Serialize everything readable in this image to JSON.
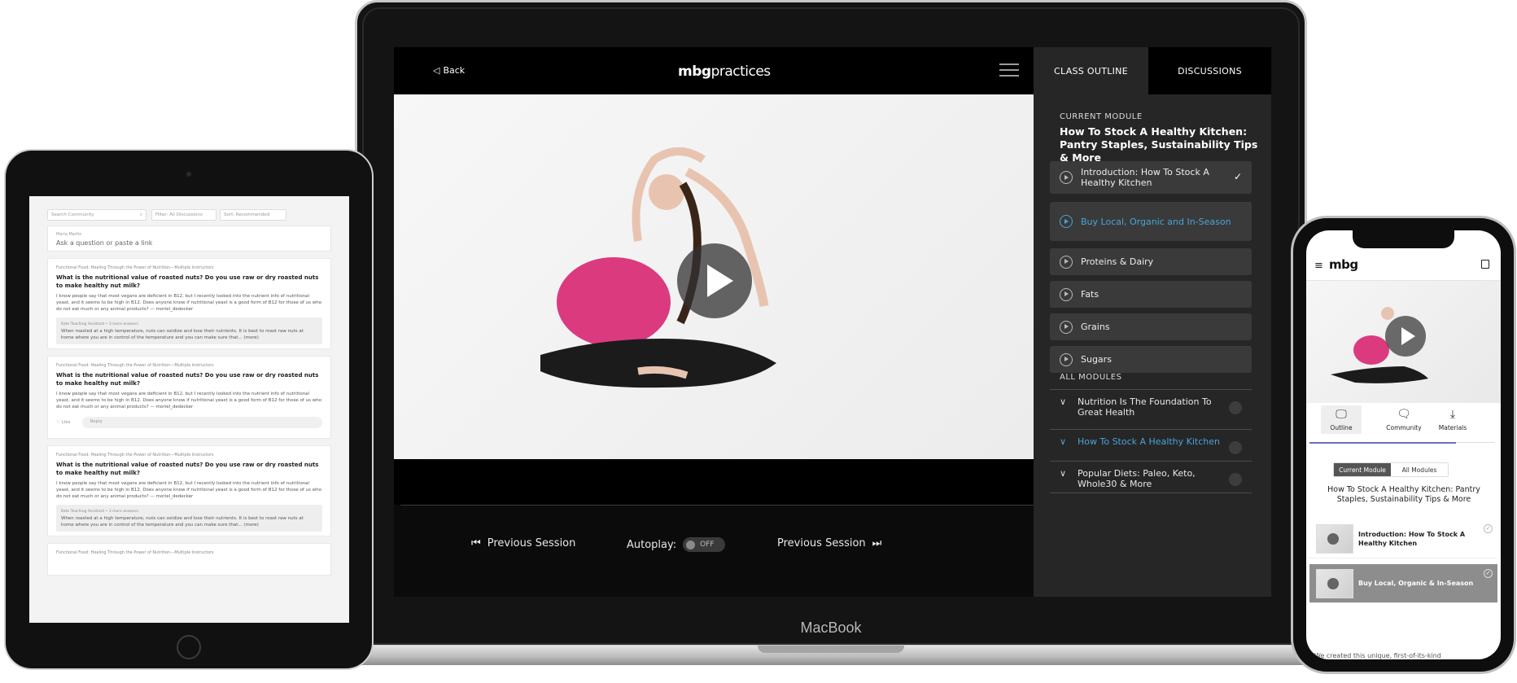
{
  "laptop": {
    "brand": "MacBook",
    "header": {
      "back_label": "Back",
      "logo_bold": "mbg",
      "logo_rest": "practices"
    },
    "controls": {
      "prev_label": "Previous Session",
      "autoplay_label": "Autoplay:",
      "autoplay_state": "OFF",
      "next_label": "Previous Session"
    },
    "panel": {
      "tabs": [
        "CLASS OUTLINE",
        "DISCUSSIONS"
      ],
      "current_module_label": "CURRENT MODULE",
      "current_module_title": "How To Stock A Healthy Kitchen: Pantry Staples, Sustainability Tips & More",
      "lessons": [
        {
          "label": "Introduction: How To Stock A Healthy Kitchen",
          "done": true
        },
        {
          "label": "Buy Local, Organic and In-Season",
          "active": true
        },
        {
          "label": "Proteins & Dairy"
        },
        {
          "label": "Fats"
        },
        {
          "label": "Grains"
        },
        {
          "label": "Sugars"
        }
      ],
      "all_modules_label": "ALL MODULES",
      "modules": [
        {
          "label": "Nutrition Is The Foundation To Great Health"
        },
        {
          "label": "How To Stock A Healthy Kitchen",
          "active": true
        },
        {
          "label": "Popular Diets: Paleo, Keto, Whole30 & More"
        }
      ]
    }
  },
  "tablet": {
    "search_placeholder": "Search Community",
    "filter_label": "Filter: All Discussions",
    "sort_label": "Sort: Recommended",
    "ask_name": "Maria Martin",
    "ask_placeholder": "Ask a question or paste a link",
    "posts": [
      {
        "meta": "Functional Food: Healing Through the Power of Nutrition—Multiple Instructors",
        "title": "What is the nutritional value of roasted nuts? Do you use raw or dry roasted nuts to make healthy nut milk?",
        "body": "I know people say that most vegans are deficient in B12, but I recently looked into the nutrient info of nutritional yeast, and it seems to be high in B12. Does anyone know if nutritional yeast is a good form of B12 for those of us who do not eat much or any animal products? — moriel_dedecker",
        "answer_meta": "Kate Teaching Assistant • 3 more answers",
        "answer": "When roasted at a high temperature, nuts can oxidize and lose their nutrients. It is best to roast raw nuts at home where you are in control of the temperature and you can make sure that... (more)"
      },
      {
        "meta": "Functional Food: Healing Through the Power of Nutrition—Multiple Instructors",
        "title": "What is the nutritional value of roasted nuts? Do you use raw or dry roasted nuts to make healthy nut milk?",
        "body": "I know people say that most vegans are deficient in B12, but I recently looked into the nutrient info of nutritional yeast, and it seems to be high in B12. Does anyone know if nutritional yeast is a good form of B12 for those of us who do not eat much or any animal products? — moriel_dedecker",
        "like_label": "Like",
        "reply_label": "Reply"
      },
      {
        "meta": "Functional Food: Healing Through the Power of Nutrition—Multiple Instructors",
        "title": "What is the nutritional value of roasted nuts? Do you use raw or dry roasted nuts to make healthy nut milk?",
        "body": "I know people say that most vegans are deficient in B12, but I recently looked into the nutrient info of nutritional yeast, and it seems to be high in B12. Does anyone know if nutritional yeast is a good form of B12 for those of us who do not eat much or any animal products? — moriel_dedecker",
        "answer_meta": "Kate Teaching Assistant • 3 more answers",
        "answer": "When roasted at a high temperature, nuts can oxidize and lose their nutrients. It is best to roast raw nuts at home where you are in control of the temperature and you can make sure that... (more)"
      },
      {
        "meta": "Functional Food: Healing Through the Power of Nutrition—Multiple Instructors"
      }
    ]
  },
  "phone": {
    "logo": "mbg",
    "tabs": [
      "Outline",
      "Community",
      "Materials"
    ],
    "segments": [
      "Current Module",
      "All Modules"
    ],
    "module_title": "How To Stock A Healthy Kitchen: Pantry Staples, Sustainability Tips & More",
    "lessons": [
      {
        "label": "Introduction: How To Stock A Healthy Kitchen"
      },
      {
        "label": "Buy Local, Organic & In-Season",
        "selected": true
      }
    ],
    "footer_text": "We created this unique, first-of-its-kind"
  }
}
